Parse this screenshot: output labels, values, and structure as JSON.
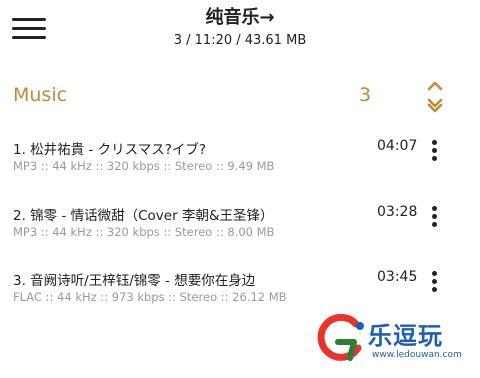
{
  "header": {
    "title": "纯音乐→",
    "subtitle": "3 / 11:20 / 43.61 MB",
    "menu_icon": "hamburger-menu-icon"
  },
  "section": {
    "label": "Music",
    "count": "3",
    "collapse_icon": "chevron-up-down-icon",
    "accent_color": "#c08a36"
  },
  "tracks": [
    {
      "title": "1. 松井祐貴 - クリスマス?イブ?",
      "meta": "MP3 :: 44 kHz :: 320 kbps :: Stereo :: 9.49 MB",
      "duration": "04:07"
    },
    {
      "title": "2. 锦零 - 情话微甜（Cover 李朝&王圣锋）",
      "meta": "MP3 :: 44 kHz :: 320 kbps :: Stereo :: 8.00 MB",
      "duration": "03:28"
    },
    {
      "title": "3. 音阙诗听/王梓钰/锦零 - 想要你在身边",
      "meta": "FLAC :: 44 kHz :: 973 kbps :: Stereo :: 26.12 MB",
      "duration": "03:45"
    }
  ],
  "watermark": {
    "name": "乐逗玩",
    "url": "www.ledouwan.com",
    "colors": [
      "#e8352c",
      "#2e7d32",
      "#1e5fb4"
    ]
  }
}
